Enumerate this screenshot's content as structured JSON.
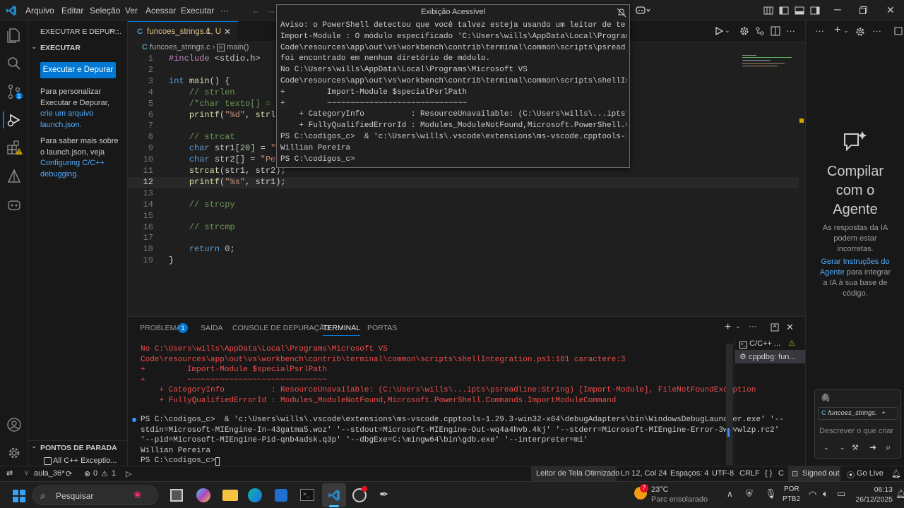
{
  "titlebar": {
    "menus": [
      "Arquivo",
      "Editar",
      "Seleção",
      "Ver",
      "Acessar",
      "Executar",
      "···"
    ]
  },
  "sidebar": {
    "header": "EXECUTAR E DEPUR...",
    "section": "EXECUTAR",
    "run_button": "Executar e Depurar",
    "text1a": "Para personalizar",
    "text1b": "Executar e Depurar,",
    "link1a": "crie um arquivo",
    "link1b": "launch.json.",
    "text2a": "Para saber mais sobre",
    "text2b": "o launch.json, veja",
    "link2a": "Configuring C/C++",
    "link2b": "debugging.",
    "breakpoints_header": "PONTOS DE PARADA",
    "breakpoint_item": "All C++ Exceptio..."
  },
  "editor": {
    "tab_label": "funcoes_strings.c",
    "tab_status": "1, U",
    "breadcrumb_file": "funcoes_strings.c",
    "breadcrumb_symbol": "main()",
    "lines": [
      {
        "n": "1",
        "t": "#include <stdio.h>"
      },
      {
        "n": "2",
        "t": ""
      },
      {
        "n": "3",
        "t": "int main() {"
      },
      {
        "n": "4",
        "t": "    // strlen"
      },
      {
        "n": "5",
        "t": "    /*char texto[] = \"Wi"
      },
      {
        "n": "6",
        "t": "    printf(\"%d\", strlen("
      },
      {
        "n": "7",
        "t": ""
      },
      {
        "n": "8",
        "t": "    // strcat"
      },
      {
        "n": "9",
        "t": "    char str1[20] = \"Wil"
      },
      {
        "n": "10",
        "t": "    char str2[] = \"Perei"
      },
      {
        "n": "11",
        "t": "    strcat(str1, str2);"
      },
      {
        "n": "12",
        "t": "    printf(\"%s\", str1);"
      },
      {
        "n": "13",
        "t": ""
      },
      {
        "n": "14",
        "t": "    // strcpy"
      },
      {
        "n": "15",
        "t": ""
      },
      {
        "n": "16",
        "t": "    // strcmp"
      },
      {
        "n": "17",
        "t": ""
      },
      {
        "n": "18",
        "t": "    return 0;"
      },
      {
        "n": "19",
        "t": "}"
      }
    ]
  },
  "overlay": {
    "title": "Exibição Acessível",
    "lines": [
      "Aviso: o PowerShell detectou que você talvez esteja usando um leitor de tela",
      "Import-Module : O módulo especificado 'C:\\Users\\wills\\AppData\\Local\\Programs\\",
      "Code\\resources\\app\\out\\vs\\workbench\\contrib\\terminal\\common\\scripts\\psreadlin",
      "foi encontrado em nenhum diretório de módulo.",
      "No C:\\Users\\wills\\AppData\\Local\\Programs\\Microsoft VS",
      "Code\\resources\\app\\out\\vs\\workbench\\contrib\\terminal\\common\\scripts\\shellInte",
      "+         Import-Module $specialPsrlPath",
      "+         ~~~~~~~~~~~~~~~~~~~~~~~~~~~~~~",
      "    + CategoryInfo          : ResourceUnavailable: (C:\\Users\\wills\\...ipts\\ps",
      "    + FullyQualifiedErrorId : Modules_ModuleNotFound,Microsoft.PowerShell.Com",
      "PS C:\\codigos_c>  & 'c:\\Users\\wills\\.vscode\\extensions\\ms-vscode.cpptools-1.2",
      "Willian Pereira",
      "PS C:\\codigos_c>"
    ]
  },
  "panel": {
    "tabs": [
      "PROBLEMAS",
      "SAÍDA",
      "CONSOLE DE DEPURAÇÃO",
      "TERMINAL",
      "PORTAS"
    ],
    "problems_count": "1",
    "error_lines": [
      "No C:\\Users\\wills\\AppData\\Local\\Programs\\Microsoft VS",
      "Code\\resources\\app\\out\\vs\\workbench\\contrib\\terminal\\common\\scripts\\shellIntegration.ps1:181 caractere:3",
      "+         Import-Module $specialPsrlPath",
      "+         ~~~~~~~~~~~~~~~~~~~~~~~~~~~~~~",
      "    + CategoryInfo          : ResourceUnavailable: (C:\\Users\\wills\\...ipts\\psreadline:String) [Import-Module], FileNotFoundException",
      "    + FullyQualifiedErrorId : Modules_ModuleNotFound,Microsoft.PowerShell.Commands.ImportModuleCommand"
    ],
    "cmd_lines": [
      "PS C:\\codigos_c>  & 'c:\\Users\\wills\\.vscode\\extensions\\ms-vscode.cpptools-1.29.3-win32-x64\\debugAdapters\\bin\\WindowsDebugLauncher.exe' '--",
      "stdin=Microsoft-MIEngine-In-43gatma5.woz' '--stdout=Microsoft-MIEngine-Out-wq4a4hvb.4kj' '--stderr=Microsoft-MIEngine-Error-3wfvwlzp.rc2'",
      "'--pid=Microsoft-MIEngine-Pid-qnb4adsk.q3p' '--dbgExe=C:\\mingw64\\bin\\gdb.exe' '--interpreter=mi'",
      "Willian Pereira",
      "PS C:\\codigos_c> "
    ],
    "term_list": [
      "C/C++ ...",
      "cppdbg: fun..."
    ]
  },
  "chat": {
    "title1": "Compilar",
    "title2": "com o",
    "title3": "Agente",
    "note": [
      "As respostas da IA",
      "podem estar",
      "incorretas."
    ],
    "link1": "Gerar Instruções do",
    "link2": "Agente",
    "rest": [
      " para integrar",
      "a IA à sua base de",
      "código."
    ],
    "context_file": "funcoes_strings.",
    "placeholder": "Descrever o que criar"
  },
  "status": {
    "branch": "aula_36*",
    "errors": "0",
    "warnings": "1",
    "screen_reader": "Leitor de Tela Otimizado",
    "position": "Ln 12, Col 24",
    "spaces": "Espaços: 4",
    "encoding": "UTF-8",
    "eol": "CRLF",
    "language": "C",
    "signed": "Signed out",
    "golive": "Go Live"
  },
  "taskbar": {
    "search": "Pesquisar",
    "weather_temp": "23°C",
    "weather_desc": "Parc ensolarado",
    "weather_badge": "7",
    "lang1": "POR",
    "lang2": "PTB2",
    "time": "06:13",
    "date": "26/12/2025"
  }
}
